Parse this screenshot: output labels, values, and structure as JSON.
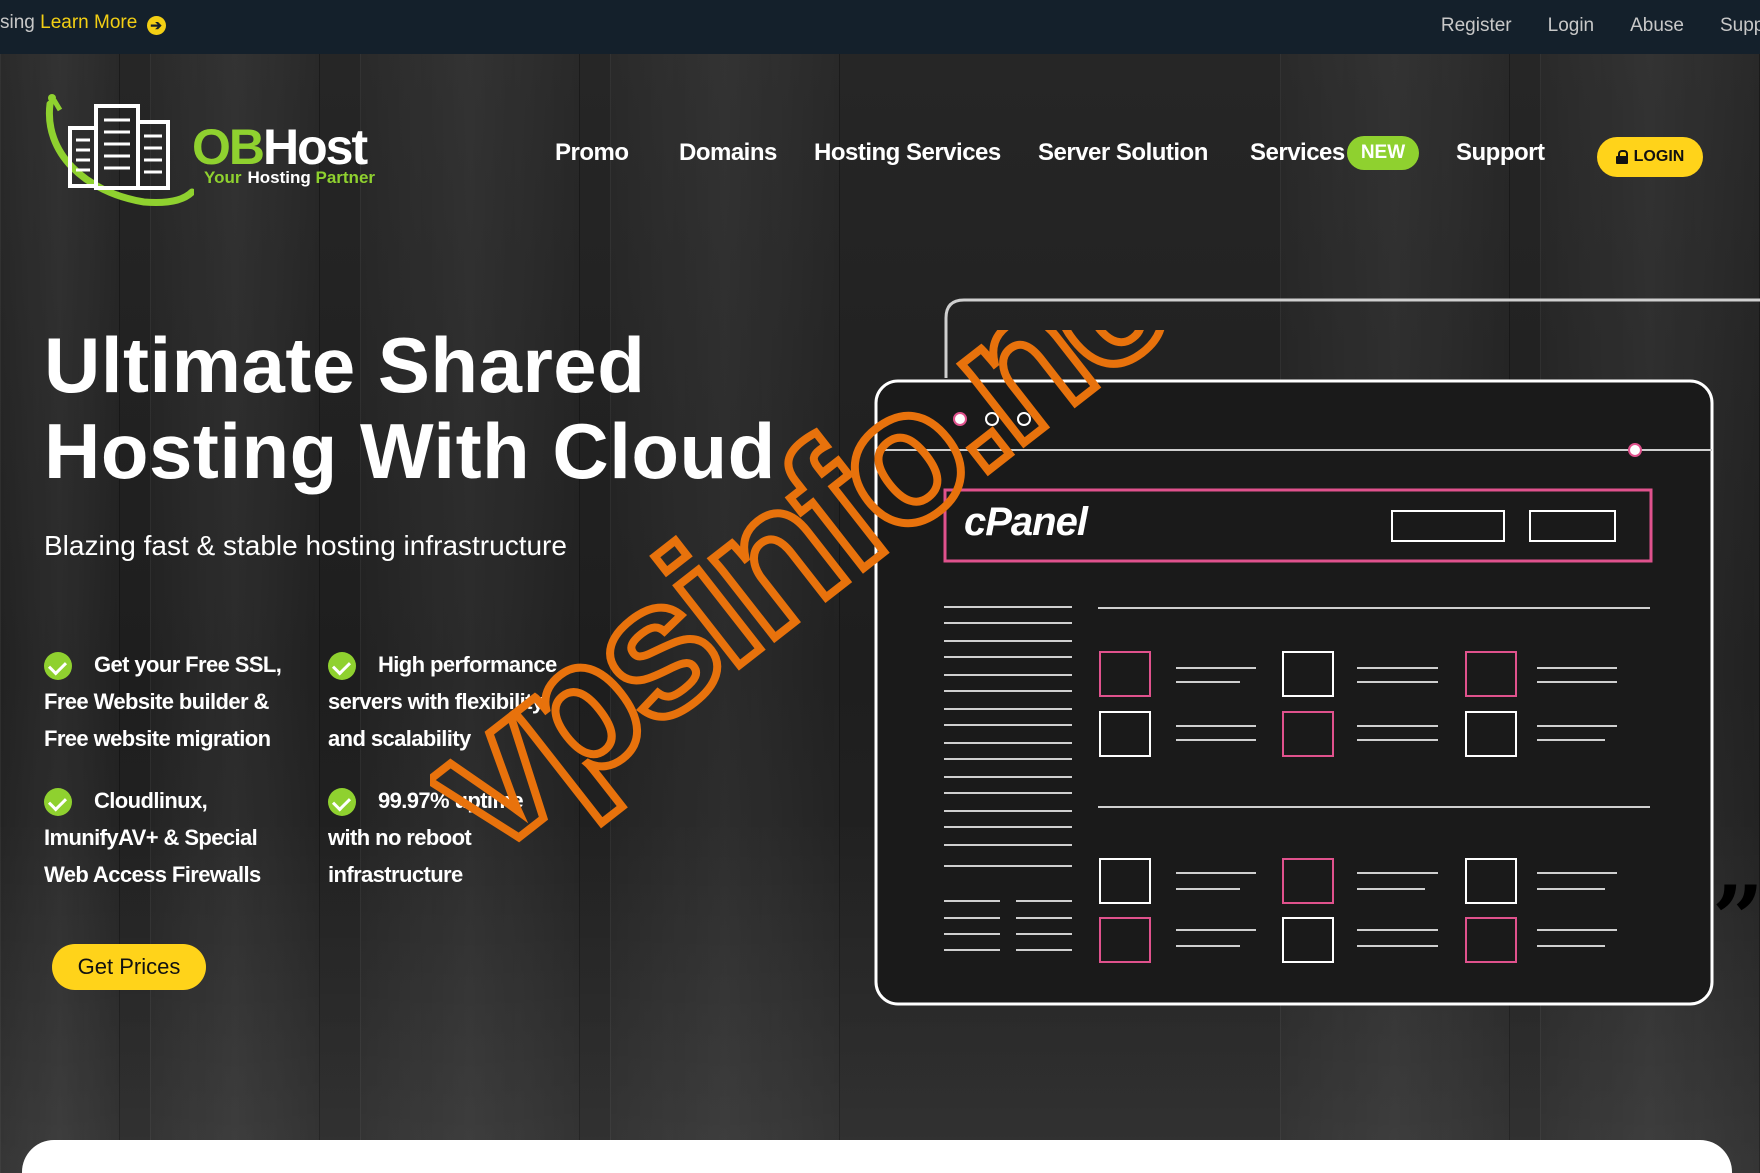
{
  "topbar": {
    "announcement_prefix": "sing",
    "learn_more": "Learn More",
    "arrow_icon": "circle-arrow-right-icon",
    "links": [
      "Register",
      "Login",
      "Abuse",
      "Supp"
    ]
  },
  "logo": {
    "brand_ob": "OB",
    "brand_host": "Host",
    "tagline_your": "Your",
    "tagline_hosting": "Hosting",
    "tagline_partner": "Partner"
  },
  "nav": {
    "items": [
      "Promo",
      "Domains",
      "Hosting Services",
      "Server Solution",
      "Services",
      "Support"
    ],
    "new_badge": "NEW",
    "login_label": "LOGIN"
  },
  "hero": {
    "headline_line1": "Ultimate Shared",
    "headline_line2": "Hosting With Cloud",
    "subheadline": "Blazing fast & stable hosting infrastructure",
    "features": [
      {
        "lines": [
          "Get your Free SSL,",
          "Free Website builder &",
          "Free website migration"
        ]
      },
      {
        "lines": [
          "High performance",
          "servers with flexibility",
          "and scalability"
        ]
      },
      {
        "lines": [
          "Cloudlinux,",
          "ImunifyAV+ & Special",
          "Web Access Firewalls"
        ]
      },
      {
        "lines": [
          "99.97% uptime",
          "with no reboot",
          "infrastructure"
        ]
      }
    ],
    "cta": "Get Prices"
  },
  "illustration": {
    "panel_logo": "cPanel",
    "accent_color": "#e0528d"
  },
  "watermark": "vpsinfo.net",
  "colors": {
    "brand_green": "#8fd12f",
    "cta_yellow": "#ffd31a",
    "topbar_bg": "#14202b",
    "watermark_orange": "#e8720c"
  }
}
